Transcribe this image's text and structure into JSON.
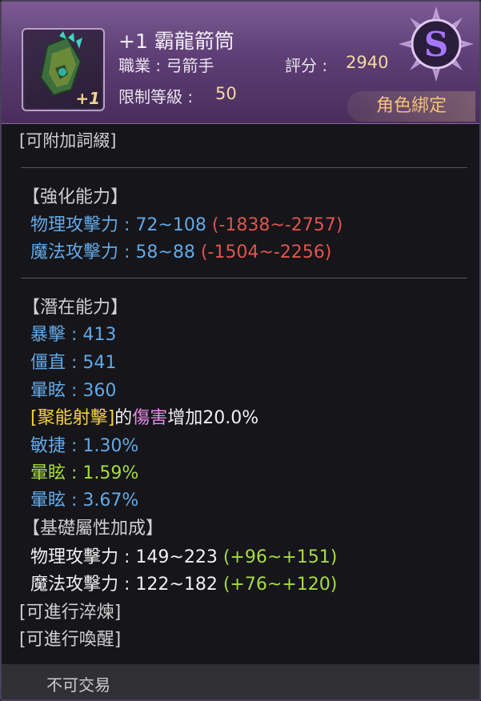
{
  "item": {
    "title": "+1 霸龍箭筒",
    "job_label": "職業 : 弓箭手",
    "score_label": "評分 :",
    "score_value": "2940",
    "level_label": "限制等級 :",
    "level_value": "50",
    "grade": "S",
    "bind_label": "角色綁定",
    "enhance_badge": "+1",
    "icon": "quiver-icon"
  },
  "sections": {
    "affix": "[可附加詞綴]",
    "enhance_title": "【強化能力】",
    "potential_title": "【潛在能力】",
    "base_title": "【基礎屬性加成】",
    "refine": "[可進行淬煉]",
    "awaken": "[可進行喚醒]"
  },
  "enhance": {
    "phys_label": "物理攻擊力 : 72~108",
    "phys_diff": "(-1838~-2757)",
    "mag_label": "魔法攻擊力 : 58~88",
    "mag_diff": "(-1504~-2256)"
  },
  "potential": {
    "crit": "暴擊 : 413",
    "stiff": "僵直 : 541",
    "stun": "暈眩 : 360",
    "skill_name": "[聚能射擊]",
    "skill_of": "的",
    "skill_dmg": "傷害",
    "skill_inc": "增加20.0%",
    "agility": "敏捷 : 1.30%",
    "stun_pct_green": "暈眩 : 1.59%",
    "stun_pct_blue": "暈眩 : 3.67%"
  },
  "base": {
    "phys": "物理攻擊力 : 149~223",
    "phys_bonus": "(+96~+151)",
    "mag": "魔法攻擊力 : 122~182",
    "mag_bonus": "(+76~+120)"
  },
  "footer": {
    "trade": "不可交易"
  },
  "colors": {
    "header": "#5e3e75",
    "blue_stat": "#63a9e6",
    "red_diff": "#e0554c",
    "green_bonus": "#a7dc3c",
    "skill_yellow": "#f5d23c",
    "damage_pink": "#e48ce6",
    "bind_orange": "#f4c07a"
  }
}
